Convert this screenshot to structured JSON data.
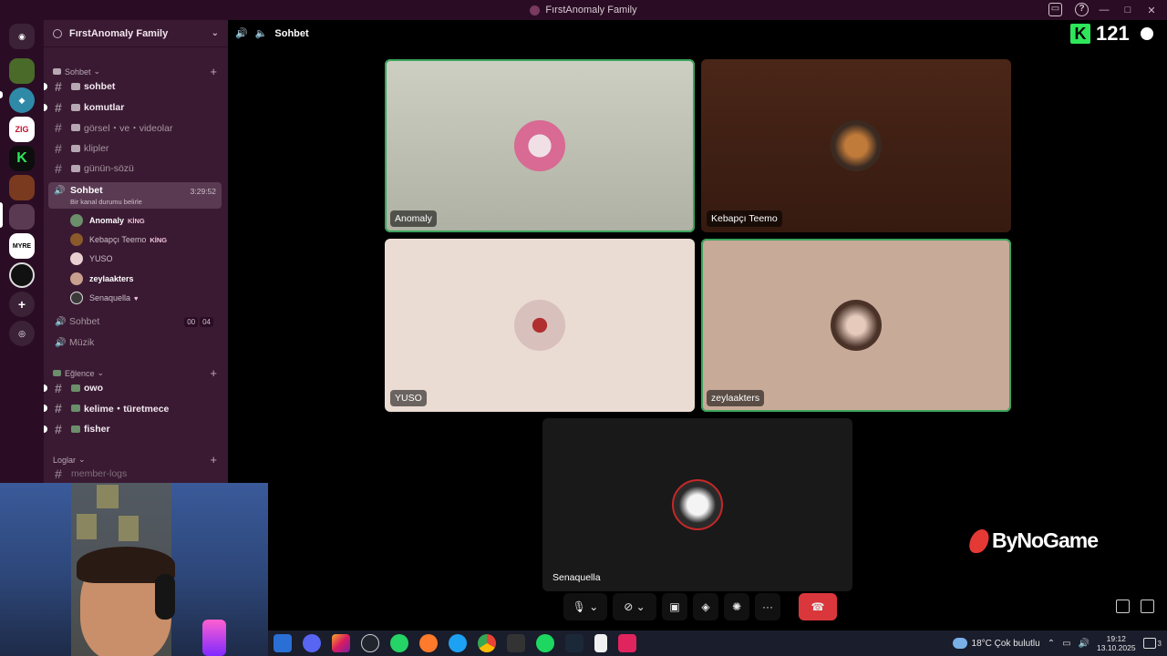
{
  "window": {
    "title": "FırstAnomaly Family"
  },
  "server": {
    "name": "FırstAnomaly Family",
    "categories": [
      {
        "label": "Sohbet"
      },
      {
        "label": "Eğlence"
      },
      {
        "label": "Loglar"
      }
    ],
    "text_channels_1": [
      {
        "name": "sohbet",
        "bold": true
      },
      {
        "name": "komutlar",
        "bold": true
      },
      {
        "name": "görsel・ve・videolar",
        "bold": false
      },
      {
        "name": "klipler",
        "bold": false
      },
      {
        "name": "günün-sözü",
        "bold": false
      }
    ],
    "active_voice": {
      "name": "Sohbet",
      "status": "Bir kanal durumu belirle",
      "duration": "3:29:52"
    },
    "members": [
      {
        "name": "Anomaly",
        "tag": "KİNG",
        "color": "#6b8f6b"
      },
      {
        "name": "Kebapçı Teemo",
        "tag": "KİNG",
        "color": "#8a5a2a"
      },
      {
        "name": "YUSO",
        "tag": "",
        "color": "#e8d0d0"
      },
      {
        "name": "zeylaakters",
        "tag": "",
        "color": "#c9a08e"
      },
      {
        "name": "Senaquella",
        "tag": "",
        "color": "#3a3a3a"
      }
    ],
    "voice_channels": [
      {
        "name": "Sohbet",
        "badge_a": "00",
        "badge_b": "04"
      },
      {
        "name": "Müzik"
      }
    ],
    "text_channels_2": [
      {
        "name": "owo"
      },
      {
        "name": "kelime・türetmece"
      },
      {
        "name": "fisher"
      }
    ],
    "text_channels_3": [
      {
        "name": "member-logs"
      }
    ]
  },
  "call": {
    "header": "Sohbet",
    "tiles": [
      {
        "name": "Anomaly",
        "bg": "#b9bcae",
        "avatar": "#d86a93",
        "speaking": true
      },
      {
        "name": "Kebapçı Teemo",
        "bg": "#3e1e13",
        "avatar": "#8a6030",
        "speaking": false
      },
      {
        "name": "YUSO",
        "bg": "#eadbd3",
        "avatar": "#d8b5b0",
        "speaking": false
      },
      {
        "name": "zeylaakters",
        "bg": "#c8aa99",
        "avatar": "#a28172",
        "speaking": true
      },
      {
        "name": "Senaquella",
        "bg": "#191919",
        "avatar": "#ececec",
        "speaking": false
      }
    ]
  },
  "kick": {
    "letter": "K",
    "count": "121"
  },
  "brand": {
    "name": "ByNoGame"
  },
  "taskbar": {
    "weather": "18°C  Çok bulutlu",
    "time": "19:12",
    "date": "13.10.2025",
    "notif_count": "3"
  }
}
